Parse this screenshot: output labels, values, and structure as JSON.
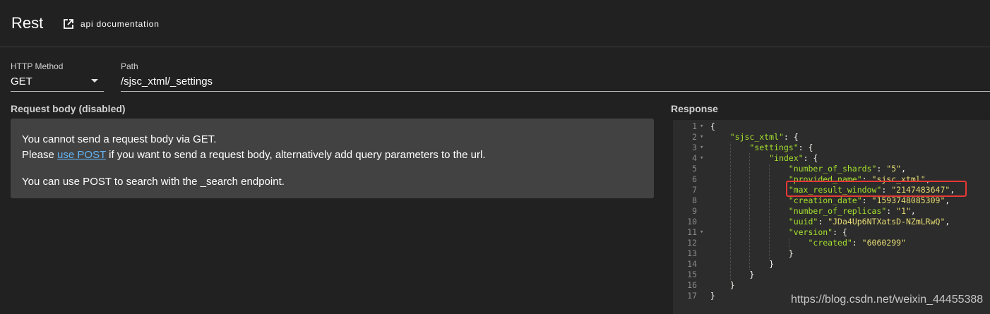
{
  "header": {
    "title": "Rest",
    "doc_link_label": "api documentation",
    "doc_link_icon": "open-in-new-icon"
  },
  "form": {
    "method_label": "HTTP Method",
    "method_value": "GET",
    "path_label": "Path",
    "path_value": "/sjsc_xtml/_settings"
  },
  "request": {
    "title": "Request body (disabled)",
    "line1": "You cannot send a request body via GET.",
    "line2_prefix": "Please ",
    "line2_link": "use POST",
    "line2_suffix": " if you want to send a request body, alternatively add query parameters to the url.",
    "line3": "You can use POST to search with the _search endpoint."
  },
  "response": {
    "title": "Response",
    "lines": [
      {
        "n": "1",
        "fold": true,
        "text": "{"
      },
      {
        "n": "2",
        "fold": true,
        "text": "    \"sjsc_xtml\": {"
      },
      {
        "n": "3",
        "fold": true,
        "text": "        \"settings\": {"
      },
      {
        "n": "4",
        "fold": true,
        "text": "            \"index\": {"
      },
      {
        "n": "5",
        "fold": false,
        "text": "                \"number_of_shards\": \"5\","
      },
      {
        "n": "6",
        "fold": false,
        "text": "                \"provided_name\": \"sjsc_xtml\","
      },
      {
        "n": "7",
        "fold": false,
        "text": "                \"max_result_window\": \"2147483647\","
      },
      {
        "n": "8",
        "fold": false,
        "text": "                \"creation_date\": \"1593748085309\","
      },
      {
        "n": "9",
        "fold": false,
        "text": "                \"number_of_replicas\": \"1\","
      },
      {
        "n": "10",
        "fold": false,
        "text": "                \"uuid\": \"JDa4Up6NTXatsD-NZmLRwQ\","
      },
      {
        "n": "11",
        "fold": true,
        "text": "                \"version\": {"
      },
      {
        "n": "12",
        "fold": false,
        "text": "                    \"created\": \"6060299\""
      },
      {
        "n": "13",
        "fold": false,
        "text": "                }"
      },
      {
        "n": "14",
        "fold": false,
        "text": "            }"
      },
      {
        "n": "15",
        "fold": false,
        "text": "        }"
      },
      {
        "n": "16",
        "fold": false,
        "text": "    }"
      },
      {
        "n": "17",
        "fold": false,
        "text": "}"
      }
    ]
  },
  "watermark": "https://blog.csdn.net/weixin_44455388",
  "colors": {
    "background": "#212121",
    "panel": "#424242",
    "editor": "#2c2c2c",
    "json_key": "#a6e22e",
    "json_string": "#e6db74",
    "link": "#64b5f6",
    "highlight": "#e53935"
  }
}
